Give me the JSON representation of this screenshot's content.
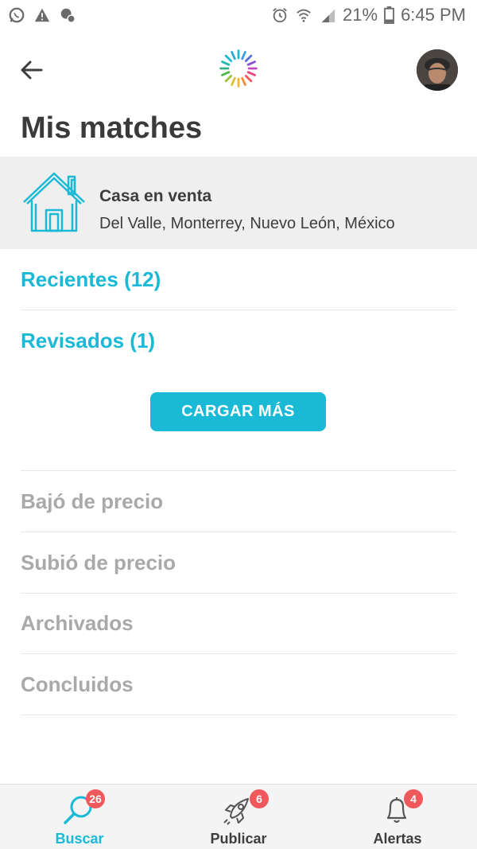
{
  "status_bar": {
    "battery": "21%",
    "time": "6:45 PM",
    "icons": [
      "whatsapp-icon",
      "warning-icon",
      "location-icon",
      "alarm-icon",
      "wifi-icon",
      "signal-icon",
      "battery-icon"
    ]
  },
  "header": {
    "title": "Mis matches",
    "back_icon": "arrow-left-icon",
    "logo_icon": "sunburst-logo-icon",
    "avatar": "user-avatar"
  },
  "property": {
    "icon": "house-icon",
    "title": "Casa en venta",
    "location": "Del Valle, Monterrey, Nuevo León, México"
  },
  "sections": {
    "recientes": "Recientes (12)",
    "revisados": "Revisados (1)",
    "load_more": "CARGAR MÁS",
    "bajo_precio": "Bajó de precio",
    "subio_precio": "Subió de precio",
    "archivados": "Archivados",
    "concluidos": "Concluidos"
  },
  "bottom_nav": {
    "items": [
      {
        "label": "Buscar",
        "badge": "26",
        "icon": "search-icon",
        "active": true
      },
      {
        "label": "Publicar",
        "badge": "6",
        "icon": "rocket-icon",
        "active": false
      },
      {
        "label": "Alertas",
        "badge": "4",
        "icon": "bell-icon",
        "active": false
      }
    ]
  },
  "colors": {
    "accent": "#1ab9d6",
    "badge": "#f0585b",
    "muted_text": "#a9a9a9",
    "card_bg": "#efefef"
  }
}
